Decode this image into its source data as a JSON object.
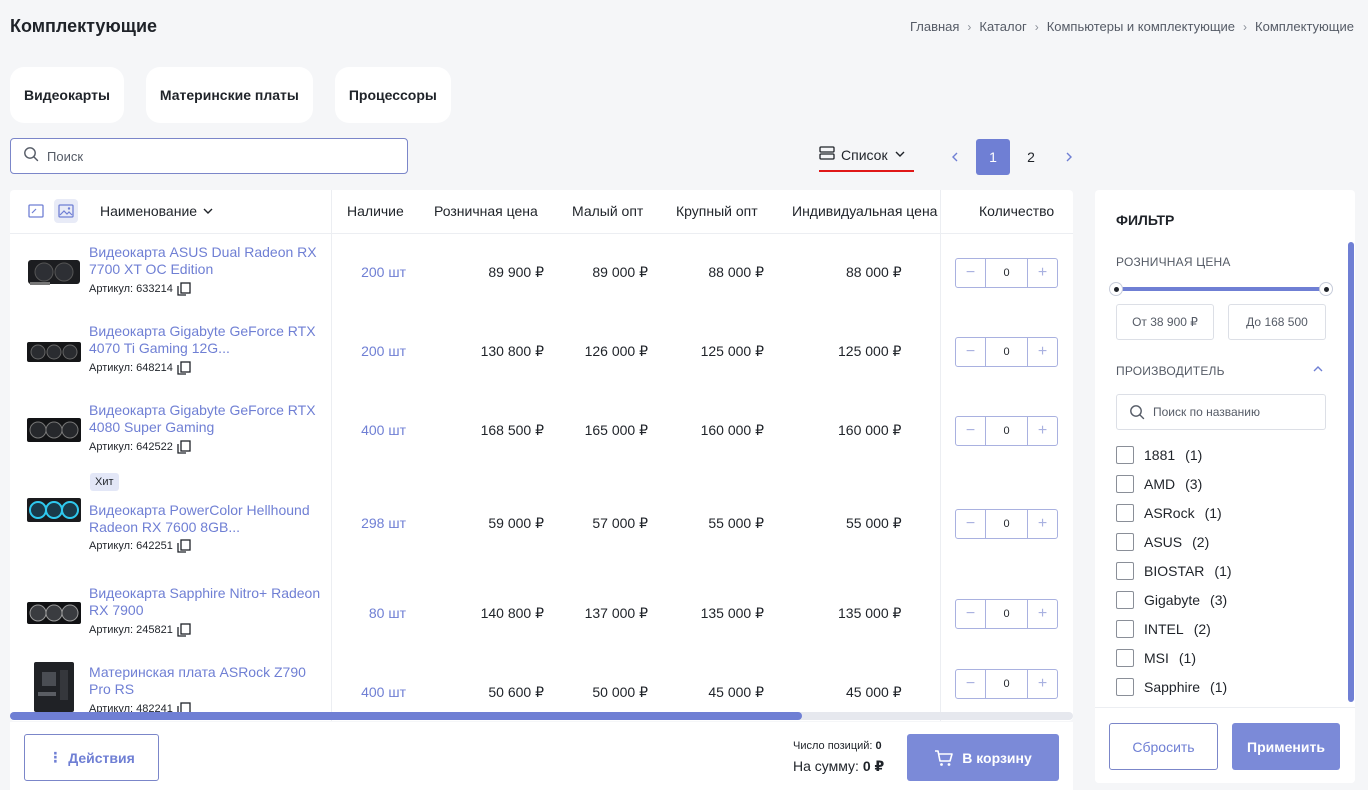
{
  "page": {
    "title": "Комплектующие"
  },
  "breadcrumb": [
    "Главная",
    "Каталог",
    "Компьютеры и комплектующие",
    "Комплектующие"
  ],
  "categories": [
    "Видеокарты",
    "Материнские платы",
    "Процессоры"
  ],
  "search": {
    "placeholder": "Поиск"
  },
  "view": {
    "label": "Список"
  },
  "pagination": {
    "pages": [
      "1",
      "2"
    ],
    "current": "1"
  },
  "table": {
    "headers": {
      "name": "Наименование",
      "stock": "Наличие",
      "retail": "Розничная цена",
      "small": "Малый опт",
      "large": "Крупный опт",
      "individual": "Индивидуальная цена",
      "qty": "Количество"
    },
    "rows": [
      {
        "name": "Видеокарта ASUS Dual Radeon RX 7700 XT OC Edition",
        "sku": "Артикул: 633214",
        "stock": "200 шт",
        "retail": "89 900 ₽",
        "small": "89 000 ₽",
        "large": "88 000 ₽",
        "individual": "88 000 ₽",
        "qty": "0",
        "badge": ""
      },
      {
        "name": "Видеокарта Gigabyte GeForce RTX 4070 Ti Gaming 12G...",
        "sku": "Артикул: 648214",
        "stock": "200 шт",
        "retail": "130 800 ₽",
        "small": "126 000 ₽",
        "large": "125 000 ₽",
        "individual": "125 000 ₽",
        "qty": "0",
        "badge": ""
      },
      {
        "name": "Видеокарта Gigabyte GeForce RTX 4080 Super Gaming",
        "sku": "Артикул: 642522",
        "stock": "400 шт",
        "retail": "168 500 ₽",
        "small": "165 000 ₽",
        "large": "160 000 ₽",
        "individual": "160 000 ₽",
        "qty": "0",
        "badge": ""
      },
      {
        "name": "Видеокарта PowerColor Hellhound Radeon RX 7600 8GB...",
        "sku": "Артикул: 642251",
        "stock": "298 шт",
        "retail": "59 000 ₽",
        "small": "57 000 ₽",
        "large": "55 000 ₽",
        "individual": "55 000 ₽",
        "qty": "0",
        "badge": "Хит"
      },
      {
        "name": "Видеокарта Sapphire Nitro+ Radeon RX 7900",
        "sku": "Артикул: 245821",
        "stock": "80 шт",
        "retail": "140 800 ₽",
        "small": "137 000 ₽",
        "large": "135 000 ₽",
        "individual": "135 000 ₽",
        "qty": "0",
        "badge": ""
      },
      {
        "name": "Материнская плата ASRock Z790 Pro RS",
        "sku": "Артикул: 482241",
        "stock": "400 шт",
        "retail": "50 600 ₽",
        "small": "50 000 ₽",
        "large": "45 000 ₽",
        "individual": "45 000 ₽",
        "qty": "0",
        "badge": ""
      }
    ]
  },
  "footer": {
    "actions": "Действия",
    "count_label": "Число позиций:",
    "count_value": "0",
    "sum_label": "На сумму:",
    "sum_value": "0 ₽",
    "cart": "В корзину"
  },
  "filter": {
    "title": "ФИЛЬТР",
    "price_section": "РОЗНИЧНАЯ ЦЕНА",
    "price_from": "От 38 900 ₽",
    "price_to": "До 168 500",
    "maker_section": "ПРОИЗВОДИТЕЛЬ",
    "maker_search_placeholder": "Поиск по названию",
    "brands": [
      {
        "name": "1881",
        "count": "(1)"
      },
      {
        "name": "AMD",
        "count": "(3)"
      },
      {
        "name": "ASRock",
        "count": "(1)"
      },
      {
        "name": "ASUS",
        "count": "(2)"
      },
      {
        "name": "BIOSTAR",
        "count": "(1)"
      },
      {
        "name": "Gigabyte",
        "count": "(3)"
      },
      {
        "name": "INTEL",
        "count": "(2)"
      },
      {
        "name": "MSI",
        "count": "(1)"
      },
      {
        "name": "Sapphire",
        "count": "(1)"
      }
    ],
    "reset": "Сбросить",
    "apply": "Применить"
  },
  "colors": {
    "accent": "#6f7fd4",
    "button": "#7b8ad8",
    "underline": "#e01818"
  },
  "icons": [
    "search-icon",
    "list-view-icon",
    "chevron-down-icon",
    "chevron-left-icon",
    "chevron-right-icon",
    "copy-icon",
    "cart-icon",
    "more-vertical-icon",
    "chevron-up-icon",
    "image-view-icon",
    "compact-view-icon"
  ]
}
